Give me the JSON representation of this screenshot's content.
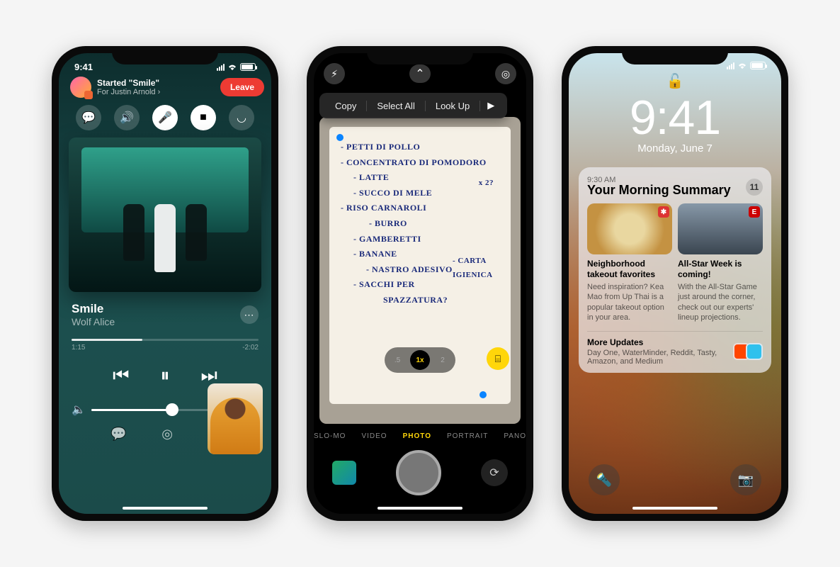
{
  "phone1": {
    "status_time": "9:41",
    "banner": {
      "title": "Started \"Smile\"",
      "subtitle": "For Justin Arnold ›",
      "leave": "Leave"
    },
    "track": {
      "title": "Smile",
      "artist": "Wolf Alice",
      "elapsed": "1:15",
      "remaining": "-2:02"
    }
  },
  "phone2": {
    "context_menu": [
      "Copy",
      "Select All",
      "Look Up"
    ],
    "note_items": [
      "- PETTI DI POLLO",
      "- CONCENTRATO DI POMODORO",
      "- LATTE",
      "- SUCCO DI MELE",
      "- RISO CARNAROLI",
      "- BURRO",
      "- GAMBERETTI",
      "- BANANE",
      "- NASTRO ADESIVO",
      "- SACCHI PER",
      "SPAZZATURA?"
    ],
    "note_aside1": "x 2?",
    "note_aside2": "- CARTA IGIENICA",
    "zoom_levels": [
      ".5",
      "1x",
      "2"
    ],
    "modes": [
      "SLO-MO",
      "VIDEO",
      "PHOTO",
      "PORTRAIT",
      "PANO"
    ]
  },
  "phone3": {
    "clock": "9:41",
    "date": "Monday, June 7",
    "summary": {
      "time": "9:30 AM",
      "title": "Your Morning Summary",
      "count": "11",
      "cards": [
        {
          "title": "Neighborhood takeout favorites",
          "body": "Need inspiration? Kea Mao from Up Thai is a popular takeout option in your area."
        },
        {
          "title": "All-Star Week is coming!",
          "body": "With the All-Star Game just around the corner, check out our experts' lineup projections."
        }
      ],
      "more": {
        "title": "More Updates",
        "body": "Day One, WaterMinder, Reddit, Tasty, Amazon, and Medium"
      }
    }
  }
}
